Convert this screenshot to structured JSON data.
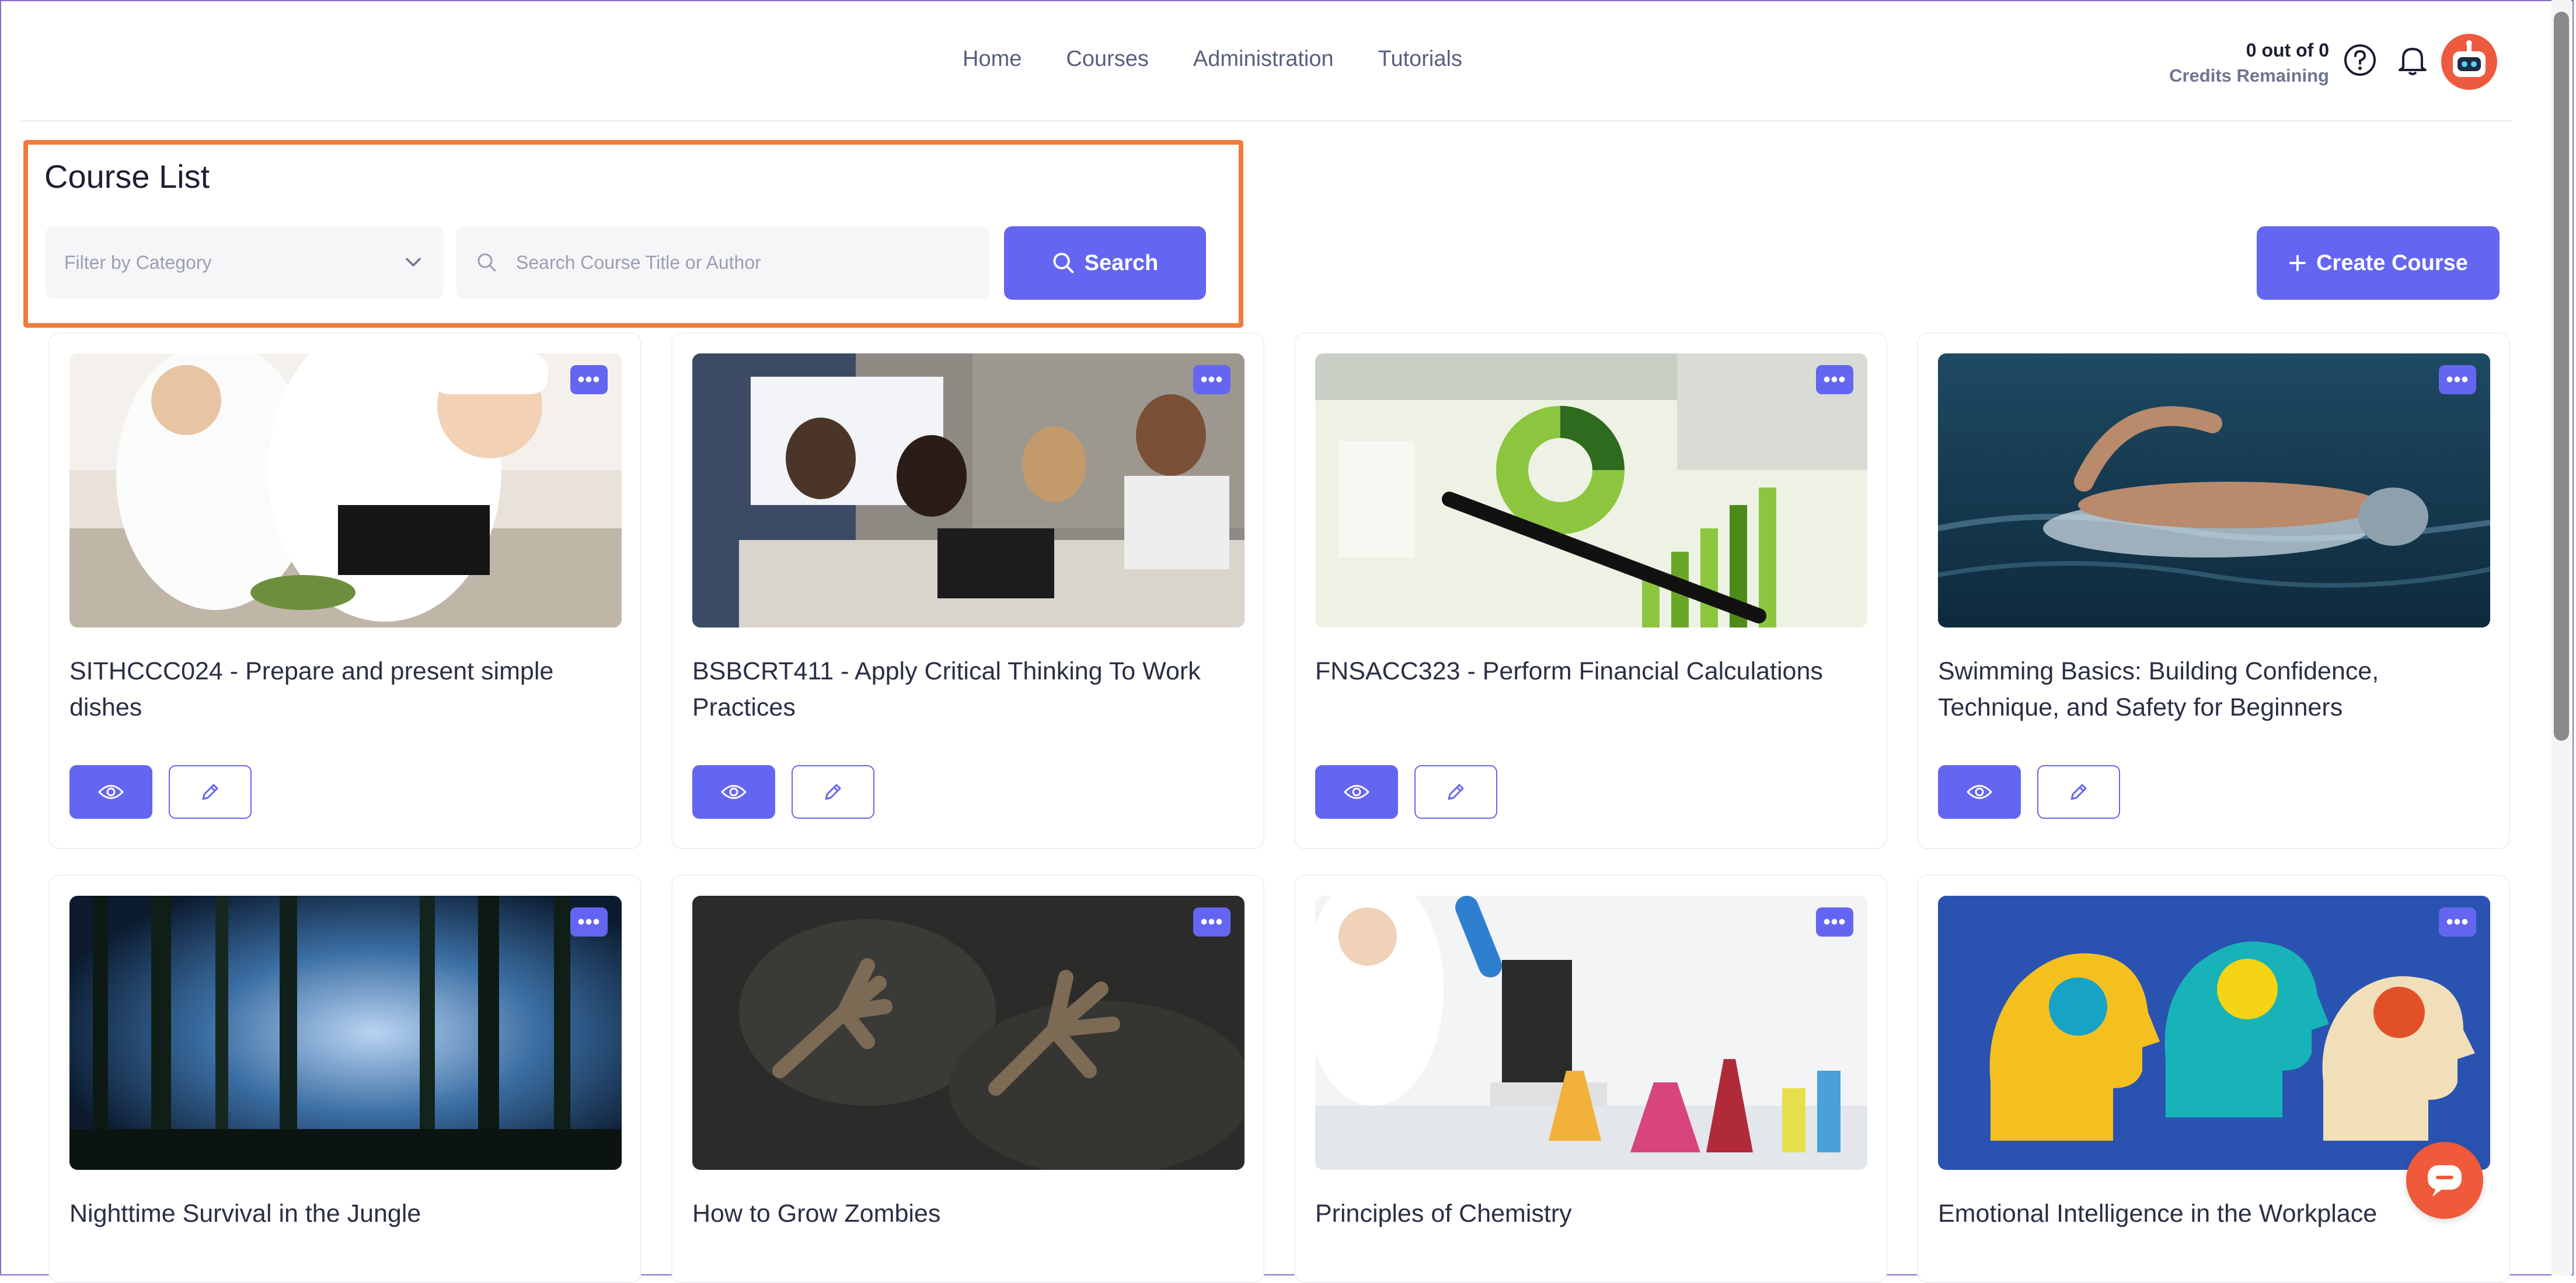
{
  "nav": {
    "items": [
      "Home",
      "Courses",
      "Administration",
      "Tutorials"
    ]
  },
  "credits": {
    "count": "0 out of 0",
    "label": "Credits Remaining"
  },
  "page": {
    "title": "Course List"
  },
  "filter": {
    "placeholder": "Filter by Category"
  },
  "search": {
    "placeholder": "Search Course Title or Author",
    "button": "Search"
  },
  "create": {
    "label": "Create Course"
  },
  "menu_glyph": "•••",
  "colors": {
    "accent": "#6466f1",
    "highlight": "#f07b3a",
    "chat": "#ef5a3a"
  },
  "courses": [
    {
      "title": "SITHCCC024 - Prepare and present simple dishes",
      "image": "chefs-cooking"
    },
    {
      "title": "BSBCRT411 - Apply Critical Thinking To Work Practices",
      "image": "team-meeting"
    },
    {
      "title": "FNSACC323  - Perform Financial Calculations",
      "image": "financial-charts"
    },
    {
      "title": "Swimming Basics: Building Confidence, Technique, and Safety for Beginners",
      "image": "swimmer"
    },
    {
      "title": "Nighttime Survival in the Jungle",
      "image": "night-forest"
    },
    {
      "title": "How to Grow Zombies",
      "image": "zombie-hands"
    },
    {
      "title": "Principles of Chemistry",
      "image": "chemistry-lab"
    },
    {
      "title": "Emotional Intelligence in the Workplace",
      "image": "heads-gears"
    }
  ]
}
